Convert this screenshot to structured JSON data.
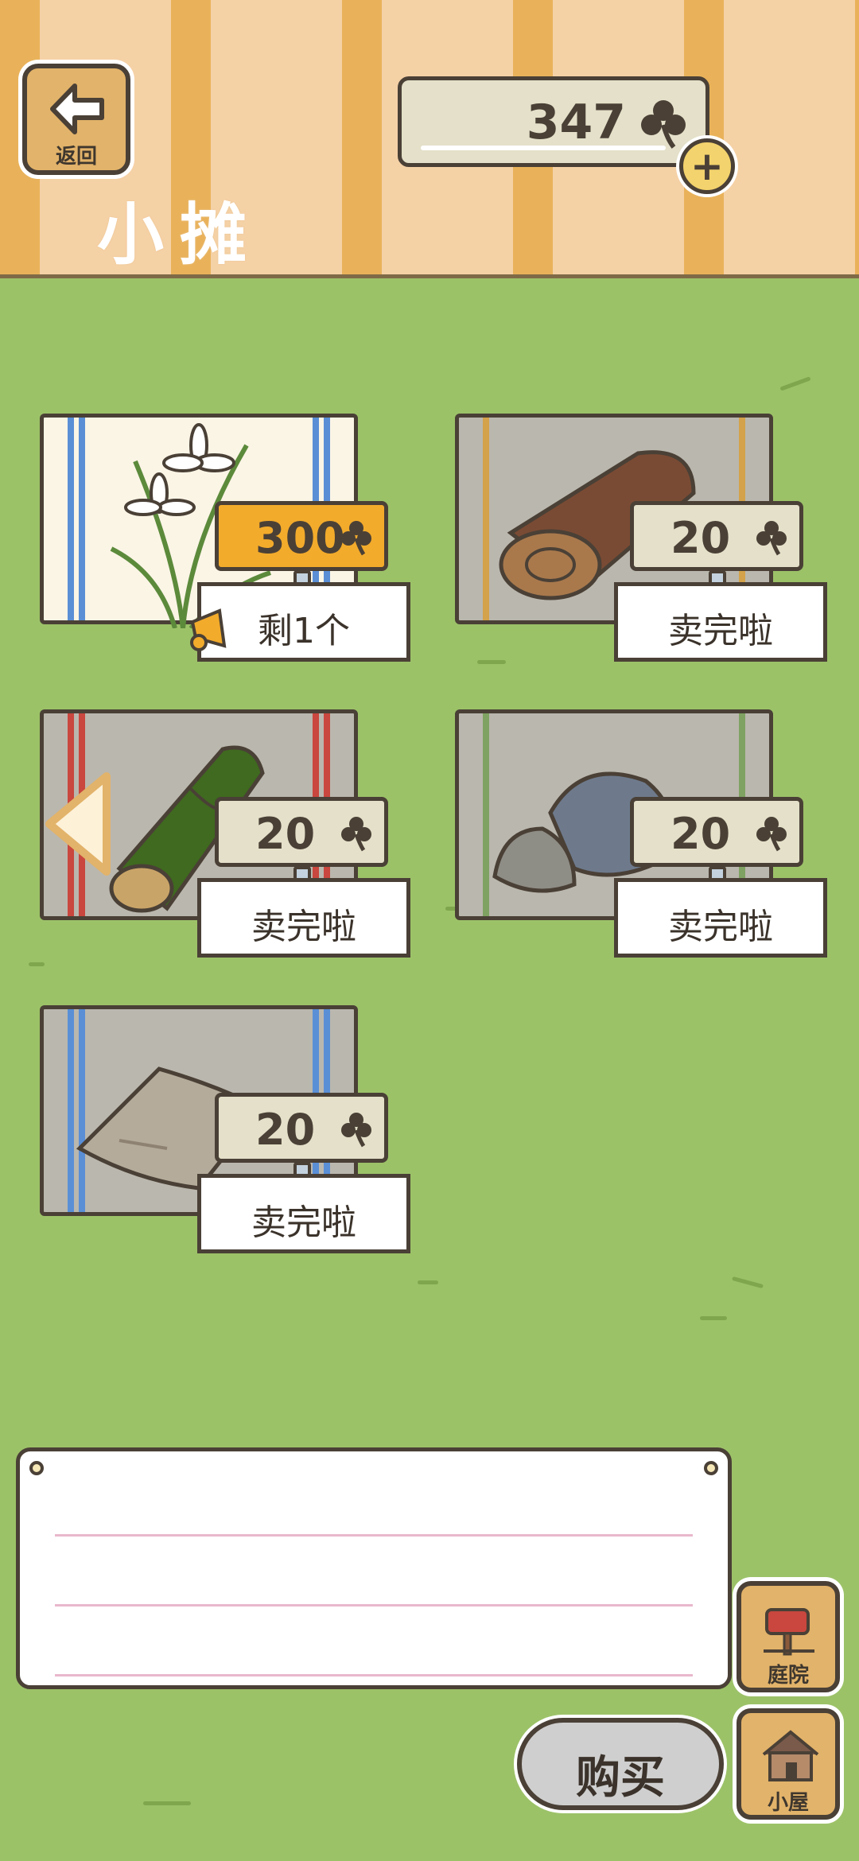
{
  "header": {
    "back_label": "返回",
    "title": "小摊",
    "currency_amount": "347",
    "currency_icon": "clover-icon"
  },
  "stalls": [
    {
      "item": "white orchid flowers",
      "price": "300",
      "status": "剩1个",
      "rug_stripe": "#5a8fd6",
      "price_bg": "#f3ab2b"
    },
    {
      "item": "wooden log",
      "price": "20",
      "status": "卖完啦",
      "rug_stripe": "#d4a24a",
      "price_bg": "#e4e0c9"
    },
    {
      "item": "bamboo",
      "price": "20",
      "status": "卖完啦",
      "rug_stripe": "#c9473e",
      "price_bg": "#e4e0c9"
    },
    {
      "item": "grey stones",
      "price": "20",
      "status": "卖完啦",
      "rug_stripe": "#7fa262",
      "price_bg": "#e4e0c9"
    },
    {
      "item": "cloth sack",
      "price": "20",
      "status": "卖完啦",
      "rug_stripe": "#5a8fd6",
      "price_bg": "#e4e0c9"
    }
  ],
  "footer": {
    "buy_label": "购买",
    "garden_label": "庭院",
    "house_label": "小屋"
  }
}
